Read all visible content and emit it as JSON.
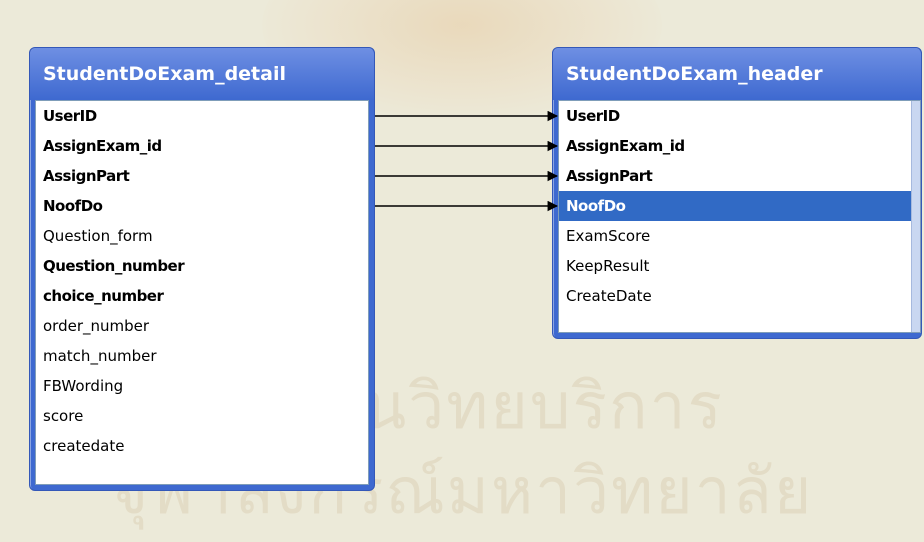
{
  "tables": {
    "detail": {
      "title": "StudentDoExam_detail",
      "fields": [
        {
          "name": "UserID",
          "key": true
        },
        {
          "name": "AssignExam_id",
          "key": true
        },
        {
          "name": "AssignPart",
          "key": true
        },
        {
          "name": "NoofDo",
          "key": true
        },
        {
          "name": "Question_form",
          "key": false
        },
        {
          "name": "Question_number",
          "key": true
        },
        {
          "name": "choice_number",
          "key": true
        },
        {
          "name": "order_number",
          "key": false
        },
        {
          "name": "match_number",
          "key": false
        },
        {
          "name": "FBWording",
          "key": false
        },
        {
          "name": "score",
          "key": false
        },
        {
          "name": "createdate",
          "key": false
        }
      ]
    },
    "header": {
      "title": "StudentDoExam_header",
      "fields": [
        {
          "name": "UserID",
          "key": true
        },
        {
          "name": "AssignExam_id",
          "key": true
        },
        {
          "name": "AssignPart",
          "key": true
        },
        {
          "name": "NoofDo",
          "key": true,
          "selected": true
        },
        {
          "name": "ExamScore",
          "key": false
        },
        {
          "name": "KeepResult",
          "key": false
        },
        {
          "name": "CreateDate",
          "key": false
        }
      ]
    }
  },
  "relationships": [
    {
      "from": "UserID",
      "to": "UserID"
    },
    {
      "from": "AssignExam_id",
      "to": "AssignExam_id"
    },
    {
      "from": "AssignPart",
      "to": "AssignPart"
    },
    {
      "from": "NoofDo",
      "to": "NoofDo"
    }
  ],
  "watermark": {
    "line1": "สถาบันวิทยบริการ",
    "line2": "จุฬาลงกรณ์มหาวิทยาลัย"
  },
  "colors": {
    "title_bar": "#3e69d0",
    "selection": "#316ac5",
    "background": "#ecead9"
  }
}
